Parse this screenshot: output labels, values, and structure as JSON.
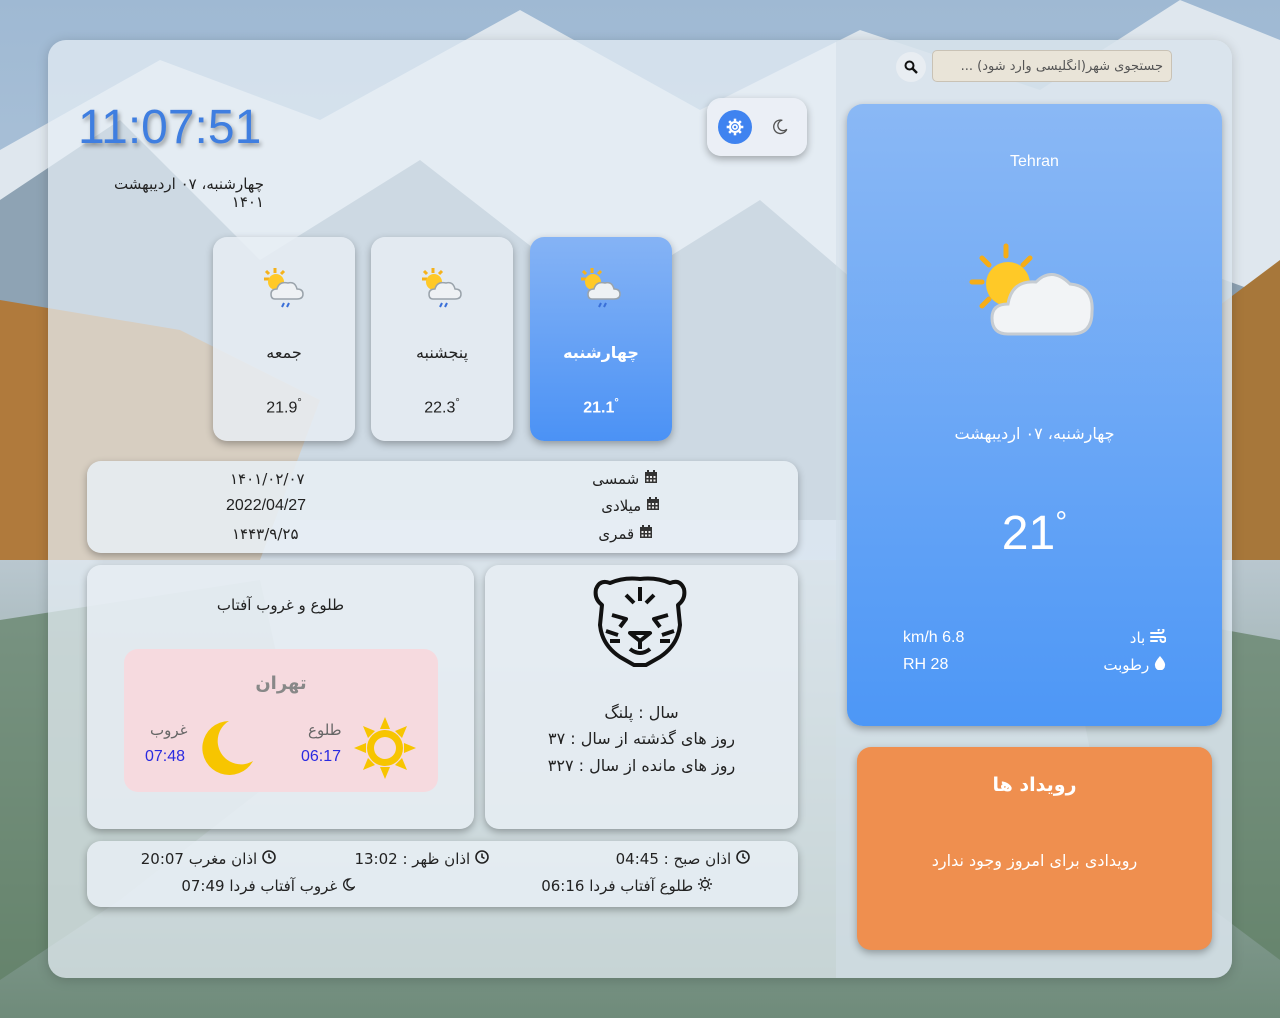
{
  "clock": {
    "time": "11:07:51",
    "date": "چهارشنبه، ۰۷ اردیبهشت ۱۴۰۱"
  },
  "forecast": [
    {
      "day": "چهارشنبه",
      "temp": "21.1",
      "active": true
    },
    {
      "day": "پنجشنبه",
      "temp": "22.3",
      "active": false
    },
    {
      "day": "جمعه",
      "temp": "21.9",
      "active": false
    }
  ],
  "degree_symbol": "°",
  "calendars": [
    {
      "label": "شمسی",
      "value": "۱۴۰۱/۰۲/۰۷"
    },
    {
      "label": "میلادی",
      "value": "2022/04/27"
    },
    {
      "label": "قمری",
      "value": "۱۴۴۳/۹/۲۵"
    }
  ],
  "sun": {
    "title": "طلوع و غروب آفتاب",
    "city": "تهران",
    "sunrise_label": "طلوع",
    "sunrise_time": "06:17",
    "sunset_label": "غروب",
    "sunset_time": "07:48"
  },
  "year": {
    "animal": "سال : پلنگ",
    "passed": "روز های گذشته از سال : ۳۷",
    "remaining": "روز های مانده از سال : ۳۲۷"
  },
  "prayer": {
    "fajr": "اذان صبح : 04:45",
    "dhuhr": "اذان ظهر : 13:02",
    "maghrib": "اذان مغرب 20:07",
    "sunrise_tomorrow": "طلوع آفتاب فردا 06:16",
    "sunset_tomorrow": "غروب آفتاب فردا 07:49"
  },
  "search": {
    "placeholder": "جستجوی شهر(انگلیسی وارد شود) ..."
  },
  "current": {
    "city": "Tehran",
    "date": "چهارشنبه، ۰۷ اردیبهشت",
    "temp": "21",
    "wind_label": "باد",
    "wind_value": "km/h 6.8",
    "humidity_label": "رطوبت",
    "humidity_value": "RH 28"
  },
  "events": {
    "title": "رویداد ها",
    "message": "رویدادی برای امروز وجود ندارد"
  },
  "colors": {
    "accent": "#3f83f0",
    "events_bg": "#ef8f4f",
    "sun_inner_bg": "#f6dadf",
    "time_blue": "#2a2ae0"
  }
}
